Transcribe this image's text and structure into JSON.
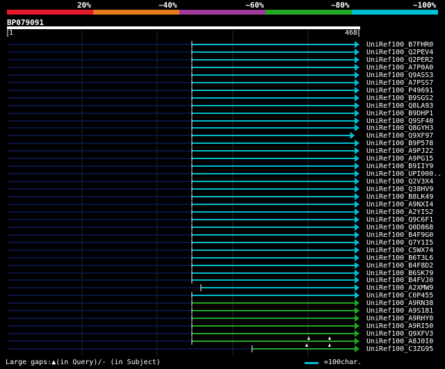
{
  "legend": {
    "bands": [
      {
        "label": "20%",
        "color": "#e8192c"
      },
      {
        "label": "~40%",
        "color": "#e87a1e"
      },
      {
        "label": "~60%",
        "color": "#a03a9a"
      },
      {
        "label": "~80%",
        "color": "#22a822"
      },
      {
        "label": "~100%",
        "color": "#00bfd0"
      }
    ]
  },
  "query": {
    "id": "BP079091",
    "start": "1",
    "end": "468"
  },
  "colors": {
    "background": "#000000",
    "guide": "#0a1440",
    "gridline": "#2a2a2a",
    "cyan": "#00bfd0",
    "green": "#22a822"
  },
  "hits": [
    {
      "label": "UniRef100_B7FHR0",
      "color": "cyan",
      "start": 246,
      "end": 468,
      "arrow": true
    },
    {
      "label": "UniRef100_Q2PEV4",
      "color": "cyan",
      "start": 246,
      "end": 468,
      "arrow": true
    },
    {
      "label": "UniRef100_Q2PER2",
      "color": "cyan",
      "start": 246,
      "end": 468,
      "arrow": true
    },
    {
      "label": "UniRef100_A7P0A0",
      "color": "cyan",
      "start": 246,
      "end": 468,
      "arrow": true
    },
    {
      "label": "UniRef100_Q9ASS3",
      "color": "cyan",
      "start": 246,
      "end": 468,
      "arrow": true
    },
    {
      "label": "UniRef100_A7PSS7",
      "color": "cyan",
      "start": 246,
      "end": 468,
      "arrow": true
    },
    {
      "label": "UniRef100_P49691",
      "color": "cyan",
      "start": 246,
      "end": 468,
      "arrow": true
    },
    {
      "label": "UniRef100_B9SGS2",
      "color": "cyan",
      "start": 246,
      "end": 468,
      "arrow": true
    },
    {
      "label": "UniRef100_Q8LA93",
      "color": "cyan",
      "start": 246,
      "end": 468,
      "arrow": true
    },
    {
      "label": "UniRef100_B9DHP1",
      "color": "cyan",
      "start": 246,
      "end": 468,
      "arrow": true
    },
    {
      "label": "UniRef100_Q9SF40",
      "color": "cyan",
      "start": 246,
      "end": 468,
      "arrow": true
    },
    {
      "label": "UniRef100_Q8GYH3",
      "color": "cyan",
      "start": 246,
      "end": 468,
      "arrow": true
    },
    {
      "label": "UniRef100_Q9XF97",
      "color": "cyan",
      "start": 246,
      "end": 462,
      "arrow": true
    },
    {
      "label": "UniRef100_B9P578",
      "color": "cyan",
      "start": 246,
      "end": 468,
      "arrow": true
    },
    {
      "label": "UniRef100_A9PJ22",
      "color": "cyan",
      "start": 246,
      "end": 468,
      "arrow": true
    },
    {
      "label": "UniRef100_A9PG15",
      "color": "cyan",
      "start": 246,
      "end": 468,
      "arrow": true
    },
    {
      "label": "UniRef100_B9IIY9",
      "color": "cyan",
      "start": 246,
      "end": 468,
      "arrow": true
    },
    {
      "label": "UniRef100_UPI000..",
      "color": "cyan",
      "start": 246,
      "end": 468,
      "arrow": true
    },
    {
      "label": "UniRef100_Q2V3X4",
      "color": "cyan",
      "start": 246,
      "end": 468,
      "arrow": true
    },
    {
      "label": "UniRef100_Q38HV9",
      "color": "cyan",
      "start": 246,
      "end": 468,
      "arrow": true
    },
    {
      "label": "UniRef100_B8LK49",
      "color": "cyan",
      "start": 246,
      "end": 468,
      "arrow": true
    },
    {
      "label": "UniRef100_A9NXI4",
      "color": "cyan",
      "start": 246,
      "end": 468,
      "arrow": true
    },
    {
      "label": "UniRef100_A2YIS2",
      "color": "cyan",
      "start": 246,
      "end": 468,
      "arrow": true
    },
    {
      "label": "UniRef100_Q9C6F1",
      "color": "cyan",
      "start": 246,
      "end": 468,
      "arrow": true
    },
    {
      "label": "UniRef100_Q0D868",
      "color": "cyan",
      "start": 246,
      "end": 468,
      "arrow": true
    },
    {
      "label": "UniRef100_B4F9G0",
      "color": "cyan",
      "start": 246,
      "end": 468,
      "arrow": true
    },
    {
      "label": "UniRef100_Q7Y1I5",
      "color": "cyan",
      "start": 246,
      "end": 468,
      "arrow": true
    },
    {
      "label": "UniRef100_C5WX74",
      "color": "cyan",
      "start": 246,
      "end": 468,
      "arrow": true
    },
    {
      "label": "UniRef100_B6T3L6",
      "color": "cyan",
      "start": 246,
      "end": 468,
      "arrow": true
    },
    {
      "label": "UniRef100_B4F8D2",
      "color": "cyan",
      "start": 246,
      "end": 468,
      "arrow": true
    },
    {
      "label": "UniRef100_B6SK79",
      "color": "cyan",
      "start": 246,
      "end": 468,
      "arrow": true
    },
    {
      "label": "UniRef100_B4FVJ0",
      "color": "cyan",
      "start": 246,
      "end": 468,
      "arrow": true
    },
    {
      "label": "UniRef100_A2XMW9",
      "color": "cyan",
      "start": 258,
      "end": 468,
      "arrow": true
    },
    {
      "label": "UniRef100_C0P455",
      "color": "cyan",
      "start": 246,
      "end": 468,
      "arrow": true
    },
    {
      "label": "UniRef100_A9RN38",
      "color": "green",
      "start": 246,
      "end": 468,
      "arrow": true
    },
    {
      "label": "UniRef100_A9S181",
      "color": "green",
      "start": 246,
      "end": 468,
      "arrow": true
    },
    {
      "label": "UniRef100_A9RHY0",
      "color": "green",
      "start": 246,
      "end": 468,
      "arrow": true
    },
    {
      "label": "UniRef100_A9RI50",
      "color": "green",
      "start": 246,
      "end": 468,
      "arrow": true
    },
    {
      "label": "UniRef100_Q9XFV3",
      "color": "green",
      "start": 246,
      "end": 468,
      "arrow": true
    },
    {
      "label": "UniRef100_A8J0I0",
      "color": "green",
      "start": 246,
      "end": 468,
      "arrow": true
    },
    {
      "label": "UniRef100_C3ZG95",
      "color": "green",
      "start": 326,
      "end": 468,
      "arrow": true
    }
  ],
  "footer": {
    "gaps_text": "Large gaps:▲(in Query)/- (in Subject)",
    "scale_text": "=100char."
  }
}
